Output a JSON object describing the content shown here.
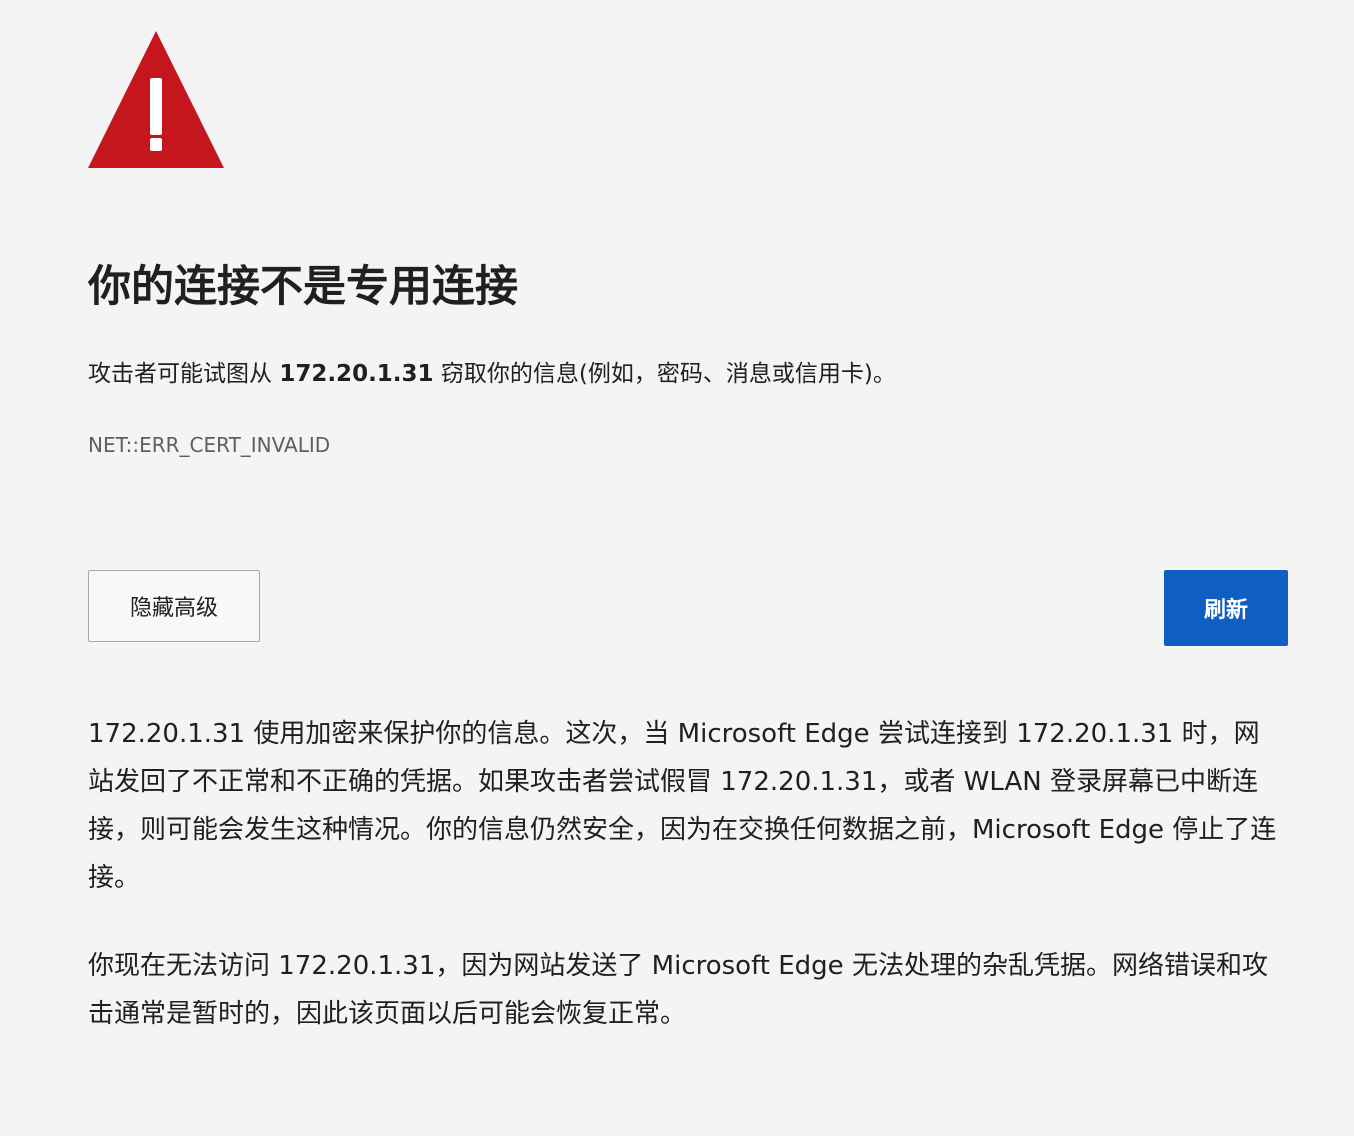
{
  "page": {
    "title": "你的连接不是专用连接",
    "summary_prefix": "攻击者可能试图从 ",
    "summary_host": "172.20.1.31",
    "summary_suffix": " 窃取你的信息(例如，密码、消息或信用卡)。",
    "error_code": "NET::ERR_CERT_INVALID"
  },
  "icons": {
    "warning": "warning-triangle-icon"
  },
  "buttons": {
    "advanced_label": "隐藏高级",
    "refresh_label": "刷新"
  },
  "details": {
    "paragraph_1": "172.20.1.31 使用加密来保护你的信息。这次，当 Microsoft Edge 尝试连接到 172.20.1.31 时，网站发回了不正常和不正确的凭据。如果攻击者尝试假冒 172.20.1.31，或者 WLAN 登录屏幕已中断连接，则可能会发生这种情况。你的信息仍然安全，因为在交换任何数据之前，Microsoft Edge 停止了连接。",
    "paragraph_2": "你现在无法访问 172.20.1.31，因为网站发送了 Microsoft Edge 无法处理的杂乱凭据。网络错误和攻击通常是暂时的，因此该页面以后可能会恢复正常。"
  },
  "colors": {
    "background": "#f4f4f4",
    "warning_red": "#c4161c",
    "primary_button": "#0f5fc2",
    "error_code_text": "#5f5f5f"
  }
}
